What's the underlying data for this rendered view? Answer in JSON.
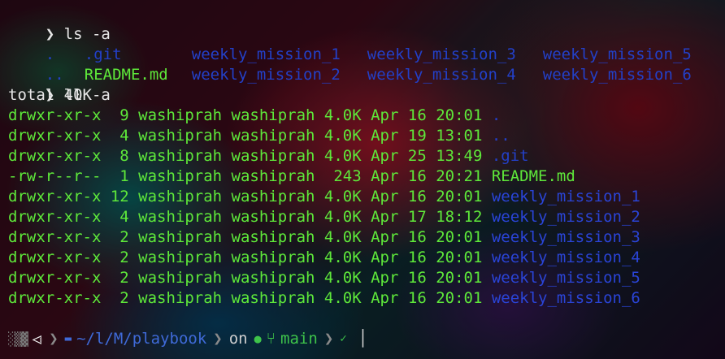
{
  "terminal": {
    "prompt_char": "❯",
    "cmd1": "ls -a",
    "ls_items": [
      [
        ".",
        ".git",
        "weekly_mission_1",
        "weekly_mission_3",
        "weekly_mission_5"
      ],
      [
        "..",
        "README.md",
        "weekly_mission_2",
        "weekly_mission_4",
        "weekly_mission_6"
      ]
    ],
    "cmd2": "ll -a",
    "total": "total 40K",
    "rows": [
      {
        "meta": "drwxr-xr-x  9 washiprah washiprah 4.0K Apr 16 20:01 ",
        "name": "."
      },
      {
        "meta": "drwxr-xr-x  4 washiprah washiprah 4.0K Apr 19 13:01 ",
        "name": ".."
      },
      {
        "meta": "drwxr-xr-x  8 washiprah washiprah 4.0K Apr 25 13:49 ",
        "name": ".git"
      },
      {
        "meta": "-rw-r--r--  1 washiprah washiprah  243 Apr 16 20:21 ",
        "name": "README.md"
      },
      {
        "meta": "drwxr-xr-x 12 washiprah washiprah 4.0K Apr 16 20:01 ",
        "name": "weekly_mission_1"
      },
      {
        "meta": "drwxr-xr-x  4 washiprah washiprah 4.0K Apr 17 18:12 ",
        "name": "weekly_mission_2"
      },
      {
        "meta": "drwxr-xr-x  2 washiprah washiprah 4.0K Apr 16 20:01 ",
        "name": "weekly_mission_3"
      },
      {
        "meta": "drwxr-xr-x  2 washiprah washiprah 4.0K Apr 16 20:01 ",
        "name": "weekly_mission_4"
      },
      {
        "meta": "drwxr-xr-x  2 washiprah washiprah 4.0K Apr 16 20:01 ",
        "name": "weekly_mission_5"
      },
      {
        "meta": "drwxr-xr-x  2 washiprah washiprah 4.0K Apr 16 20:01 ",
        "name": "weekly_mission_6"
      }
    ]
  },
  "statusbar": {
    "path": "~/l/M/playbook",
    "on": "on",
    "branch": "main",
    "icons": {
      "os": "os-icon",
      "folder": "folder-icon",
      "github": "github-icon",
      "branch": "git-branch-icon",
      "status": "check-icon"
    }
  },
  "colors": {
    "dir": "#2340c8",
    "file": "#5ee83a",
    "meta": "#5ee83a",
    "git": "#3ec44a",
    "path": "#3f6ad8"
  }
}
